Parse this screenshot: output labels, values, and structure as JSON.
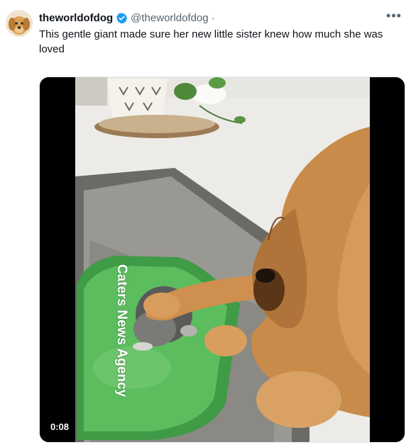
{
  "tweet": {
    "display_name": "theworldofdog",
    "handle": "@theworldofdog",
    "separator": "·",
    "more_icon": "more-horizontal-icon",
    "verified_icon": "verified-badge-icon",
    "text": "This gentle giant made sure her new little sister knew how much she was loved"
  },
  "media": {
    "watermark": "Caters News Agency",
    "duration": "0:08"
  },
  "colors": {
    "verified": "#1d9bf0",
    "handle": "#536471",
    "text": "#0f1419"
  }
}
